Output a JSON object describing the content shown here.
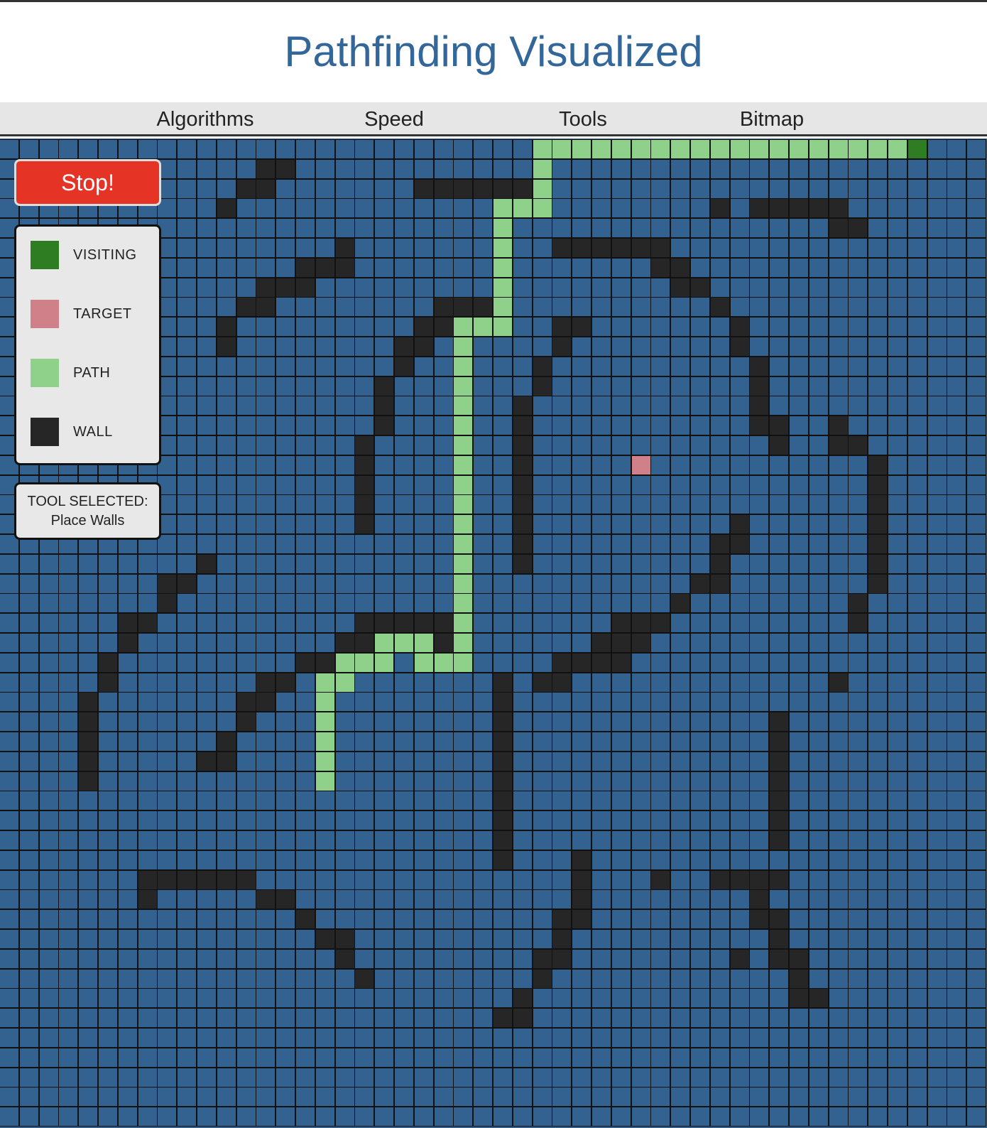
{
  "title": "Pathfinding Visualized",
  "nav": [
    {
      "label": "Algorithms"
    },
    {
      "label": "Speed"
    },
    {
      "label": "Tools"
    },
    {
      "label": "Bitmap"
    }
  ],
  "controls": {
    "stop_label": "Stop!"
  },
  "legend": [
    {
      "label": "VISITING",
      "color": "#2e7d22"
    },
    {
      "label": "TARGET",
      "color": "#d08088"
    },
    {
      "label": "PATH",
      "color": "#8fd18a"
    },
    {
      "label": "WALL",
      "color": "#262626"
    }
  ],
  "tool": {
    "heading": "TOOL SELECTED:",
    "value": "Place Walls"
  },
  "colors": {
    "empty": "#336291",
    "wall": "#262626",
    "path": "#8fd18a",
    "visiting": "#2e7d22",
    "target": "#d08088",
    "accent": "#336699",
    "stop": "#e53326"
  },
  "grid": {
    "cols": 50,
    "rows": 50,
    "walls": [
      [
        1,
        13
      ],
      [
        1,
        14
      ],
      [
        2,
        12
      ],
      [
        2,
        13
      ],
      [
        2,
        21
      ],
      [
        2,
        22
      ],
      [
        2,
        23
      ],
      [
        2,
        24
      ],
      [
        2,
        25
      ],
      [
        2,
        26
      ],
      [
        3,
        11
      ],
      [
        3,
        36
      ],
      [
        3,
        38
      ],
      [
        3,
        39
      ],
      [
        3,
        40
      ],
      [
        3,
        41
      ],
      [
        3,
        42
      ],
      [
        4,
        42
      ],
      [
        4,
        43
      ],
      [
        5,
        17
      ],
      [
        5,
        28
      ],
      [
        5,
        29
      ],
      [
        5,
        30
      ],
      [
        5,
        31
      ],
      [
        5,
        32
      ],
      [
        5,
        33
      ],
      [
        6,
        15
      ],
      [
        6,
        16
      ],
      [
        6,
        17
      ],
      [
        6,
        33
      ],
      [
        6,
        34
      ],
      [
        7,
        13
      ],
      [
        7,
        14
      ],
      [
        7,
        15
      ],
      [
        7,
        34
      ],
      [
        7,
        35
      ],
      [
        8,
        12
      ],
      [
        8,
        13
      ],
      [
        8,
        22
      ],
      [
        8,
        23
      ],
      [
        8,
        24
      ],
      [
        8,
        36
      ],
      [
        9,
        11
      ],
      [
        9,
        21
      ],
      [
        9,
        22
      ],
      [
        9,
        28
      ],
      [
        9,
        29
      ],
      [
        9,
        37
      ],
      [
        10,
        11
      ],
      [
        10,
        20
      ],
      [
        10,
        21
      ],
      [
        10,
        28
      ],
      [
        10,
        37
      ],
      [
        11,
        20
      ],
      [
        11,
        27
      ],
      [
        11,
        38
      ],
      [
        12,
        19
      ],
      [
        12,
        27
      ],
      [
        12,
        38
      ],
      [
        13,
        19
      ],
      [
        13,
        26
      ],
      [
        13,
        38
      ],
      [
        14,
        19
      ],
      [
        14,
        26
      ],
      [
        14,
        38
      ],
      [
        14,
        39
      ],
      [
        14,
        42
      ],
      [
        15,
        18
      ],
      [
        15,
        26
      ],
      [
        15,
        39
      ],
      [
        15,
        42
      ],
      [
        15,
        43
      ],
      [
        16,
        18
      ],
      [
        16,
        26
      ],
      [
        16,
        44
      ],
      [
        17,
        18
      ],
      [
        17,
        26
      ],
      [
        17,
        44
      ],
      [
        18,
        18
      ],
      [
        18,
        26
      ],
      [
        18,
        44
      ],
      [
        19,
        18
      ],
      [
        19,
        26
      ],
      [
        19,
        37
      ],
      [
        19,
        44
      ],
      [
        20,
        26
      ],
      [
        20,
        36
      ],
      [
        20,
        37
      ],
      [
        20,
        44
      ],
      [
        21,
        10
      ],
      [
        21,
        26
      ],
      [
        21,
        36
      ],
      [
        21,
        44
      ],
      [
        22,
        8
      ],
      [
        22,
        9
      ],
      [
        22,
        35
      ],
      [
        22,
        36
      ],
      [
        22,
        44
      ],
      [
        23,
        8
      ],
      [
        23,
        34
      ],
      [
        23,
        43
      ],
      [
        24,
        6
      ],
      [
        24,
        7
      ],
      [
        24,
        18
      ],
      [
        24,
        19
      ],
      [
        24,
        20
      ],
      [
        24,
        21
      ],
      [
        24,
        22
      ],
      [
        24,
        31
      ],
      [
        24,
        32
      ],
      [
        24,
        33
      ],
      [
        24,
        43
      ],
      [
        25,
        6
      ],
      [
        25,
        17
      ],
      [
        25,
        18
      ],
      [
        25,
        22
      ],
      [
        25,
        30
      ],
      [
        25,
        31
      ],
      [
        25,
        32
      ],
      [
        26,
        5
      ],
      [
        26,
        15
      ],
      [
        26,
        16
      ],
      [
        26,
        28
      ],
      [
        26,
        29
      ],
      [
        26,
        30
      ],
      [
        26,
        31
      ],
      [
        27,
        5
      ],
      [
        27,
        13
      ],
      [
        27,
        14
      ],
      [
        27,
        25
      ],
      [
        27,
        27
      ],
      [
        27,
        28
      ],
      [
        27,
        42
      ],
      [
        28,
        4
      ],
      [
        28,
        12
      ],
      [
        28,
        13
      ],
      [
        28,
        25
      ],
      [
        29,
        4
      ],
      [
        29,
        12
      ],
      [
        29,
        25
      ],
      [
        29,
        39
      ],
      [
        30,
        4
      ],
      [
        30,
        11
      ],
      [
        30,
        25
      ],
      [
        30,
        39
      ],
      [
        31,
        4
      ],
      [
        31,
        10
      ],
      [
        31,
        11
      ],
      [
        31,
        25
      ],
      [
        31,
        39
      ],
      [
        32,
        4
      ],
      [
        32,
        25
      ],
      [
        32,
        39
      ],
      [
        33,
        25
      ],
      [
        33,
        39
      ],
      [
        34,
        25
      ],
      [
        34,
        39
      ],
      [
        35,
        25
      ],
      [
        35,
        39
      ],
      [
        36,
        25
      ],
      [
        36,
        29
      ],
      [
        37,
        7
      ],
      [
        37,
        8
      ],
      [
        37,
        9
      ],
      [
        37,
        10
      ],
      [
        37,
        11
      ],
      [
        37,
        12
      ],
      [
        37,
        29
      ],
      [
        37,
        33
      ],
      [
        37,
        36
      ],
      [
        37,
        37
      ],
      [
        37,
        38
      ],
      [
        37,
        39
      ],
      [
        38,
        7
      ],
      [
        38,
        13
      ],
      [
        38,
        14
      ],
      [
        38,
        29
      ],
      [
        38,
        38
      ],
      [
        39,
        15
      ],
      [
        39,
        28
      ],
      [
        39,
        29
      ],
      [
        39,
        38
      ],
      [
        39,
        39
      ],
      [
        40,
        16
      ],
      [
        40,
        17
      ],
      [
        40,
        28
      ],
      [
        40,
        39
      ],
      [
        41,
        17
      ],
      [
        41,
        27
      ],
      [
        41,
        28
      ],
      [
        41,
        37
      ],
      [
        41,
        39
      ],
      [
        41,
        40
      ],
      [
        42,
        18
      ],
      [
        42,
        27
      ],
      [
        42,
        40
      ],
      [
        43,
        26
      ],
      [
        43,
        40
      ],
      [
        43,
        41
      ],
      [
        44,
        25
      ],
      [
        44,
        26
      ]
    ],
    "path": [
      [
        0,
        27
      ],
      [
        0,
        28
      ],
      [
        0,
        29
      ],
      [
        0,
        30
      ],
      [
        0,
        31
      ],
      [
        0,
        32
      ],
      [
        0,
        33
      ],
      [
        0,
        34
      ],
      [
        0,
        35
      ],
      [
        0,
        36
      ],
      [
        0,
        37
      ],
      [
        0,
        38
      ],
      [
        0,
        39
      ],
      [
        0,
        40
      ],
      [
        0,
        41
      ],
      [
        0,
        42
      ],
      [
        0,
        43
      ],
      [
        0,
        44
      ],
      [
        0,
        45
      ],
      [
        1,
        27
      ],
      [
        2,
        27
      ],
      [
        3,
        25
      ],
      [
        3,
        26
      ],
      [
        3,
        27
      ],
      [
        4,
        25
      ],
      [
        5,
        25
      ],
      [
        6,
        25
      ],
      [
        7,
        25
      ],
      [
        8,
        25
      ],
      [
        9,
        23
      ],
      [
        9,
        24
      ],
      [
        9,
        25
      ],
      [
        10,
        23
      ],
      [
        11,
        23
      ],
      [
        12,
        23
      ],
      [
        13,
        23
      ],
      [
        14,
        23
      ],
      [
        15,
        23
      ],
      [
        16,
        23
      ],
      [
        17,
        23
      ],
      [
        18,
        23
      ],
      [
        19,
        23
      ],
      [
        20,
        23
      ],
      [
        21,
        23
      ],
      [
        22,
        23
      ],
      [
        23,
        23
      ],
      [
        24,
        23
      ],
      [
        25,
        19
      ],
      [
        25,
        20
      ],
      [
        25,
        21
      ],
      [
        25,
        23
      ],
      [
        26,
        17
      ],
      [
        26,
        18
      ],
      [
        26,
        19
      ],
      [
        26,
        21
      ],
      [
        26,
        22
      ],
      [
        26,
        23
      ],
      [
        27,
        16
      ],
      [
        27,
        17
      ],
      [
        28,
        16
      ],
      [
        29,
        16
      ],
      [
        30,
        16
      ],
      [
        31,
        16
      ],
      [
        32,
        16
      ]
    ],
    "visiting": [
      [
        0,
        46
      ]
    ],
    "target": [
      [
        16,
        32
      ]
    ]
  }
}
